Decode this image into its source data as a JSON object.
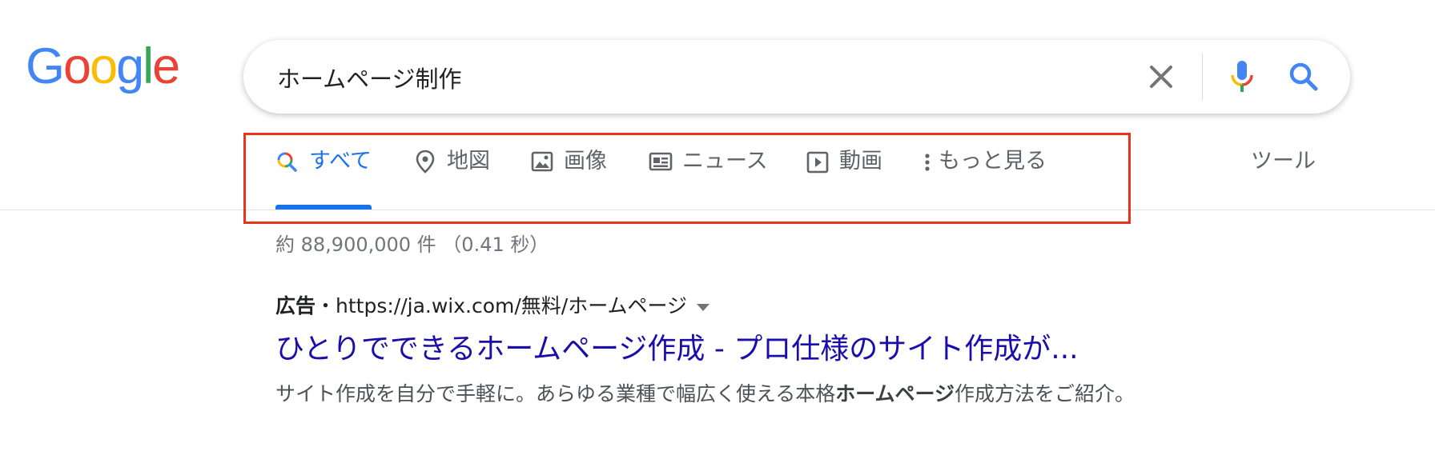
{
  "logo": {
    "letters": [
      {
        "char": "G",
        "color": "#4285F4"
      },
      {
        "char": "o",
        "color": "#EA4335"
      },
      {
        "char": "o",
        "color": "#FBBC05"
      },
      {
        "char": "g",
        "color": "#4285F4"
      },
      {
        "char": "l",
        "color": "#34A853"
      },
      {
        "char": "e",
        "color": "#EA4335"
      }
    ]
  },
  "search": {
    "query": "ホームページ制作",
    "clear_icon": "close-icon",
    "mic_icon": "microphone-icon",
    "search_icon": "search-icon"
  },
  "tabs": [
    {
      "label": "すべて",
      "icon": "search-multicolor-icon",
      "active": true
    },
    {
      "label": "地図",
      "icon": "map-pin-icon",
      "active": false
    },
    {
      "label": "画像",
      "icon": "image-icon",
      "active": false
    },
    {
      "label": "ニュース",
      "icon": "news-icon",
      "active": false
    },
    {
      "label": "動画",
      "icon": "video-icon",
      "active": false
    },
    {
      "label": "もっと見る",
      "icon": "more-vert-icon",
      "active": false
    }
  ],
  "tools_label": "ツール",
  "result_stats": "約 88,900,000 件 （0.41 秒）",
  "ad": {
    "label": "広告",
    "separator": "・",
    "url": "https://ja.wix.com/無料/ホームページ",
    "title": "ひとりでできるホームページ作成 - プロ仕様のサイト作成が...",
    "snippet_before": "サイト作成を自分で手軽に。あらゆる業種で幅広く使える本格",
    "snippet_bold": "ホームページ",
    "snippet_after": "作成方法をご紹介。"
  },
  "colors": {
    "accent": "#1a73e8",
    "link": "#1a0dab",
    "highlight_border": "#e8341c"
  }
}
